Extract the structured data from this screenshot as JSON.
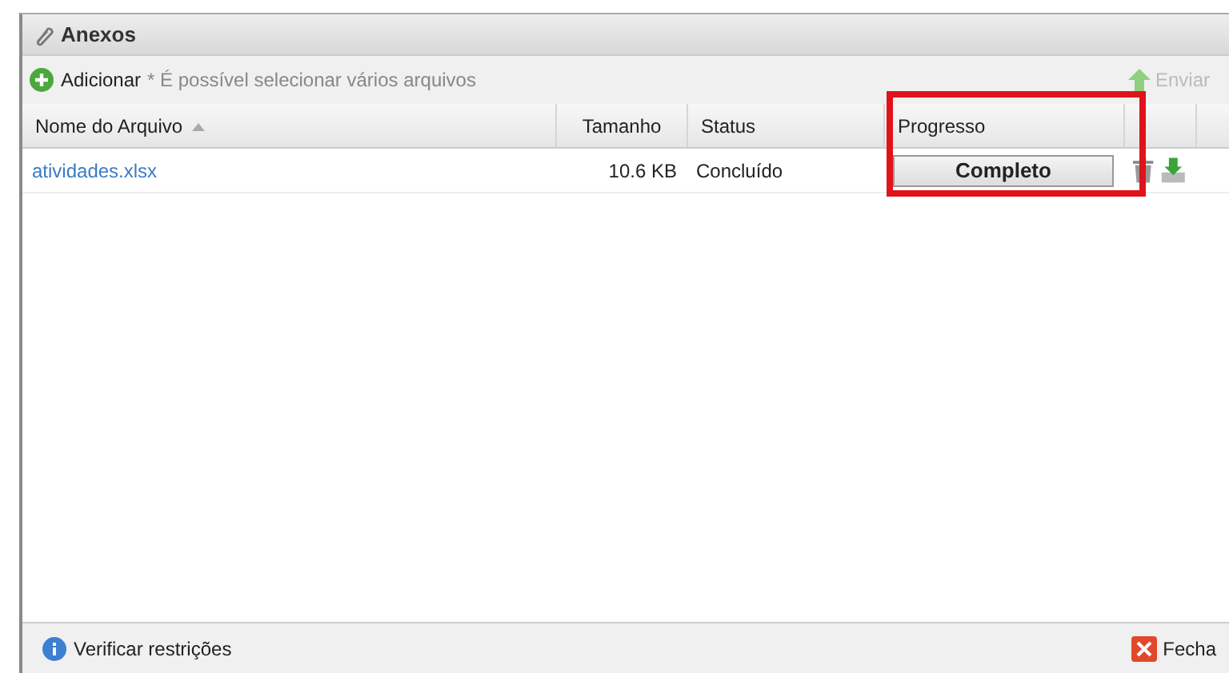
{
  "window": {
    "title": "Anexos"
  },
  "toolbar": {
    "add_button": "Adicionar",
    "hint": "* É possível selecionar vários arquivos",
    "send_button": "Enviar"
  },
  "table": {
    "columns": [
      {
        "label": "Nome do Arquivo",
        "sorted": true,
        "highlighted": false
      },
      {
        "label": "Tamanho",
        "sorted": false,
        "highlighted": false
      },
      {
        "label": "Status",
        "sorted": false,
        "highlighted": false
      },
      {
        "label": "Progresso",
        "sorted": false,
        "highlighted": true
      }
    ],
    "rows": [
      {
        "name": "atividades.xlsx",
        "size": "10.6 KB",
        "status": "Concluído",
        "progress": "Completo"
      }
    ]
  },
  "footer": {
    "restrictions_link": "Verificar restrições",
    "close_button": "Fecha"
  }
}
